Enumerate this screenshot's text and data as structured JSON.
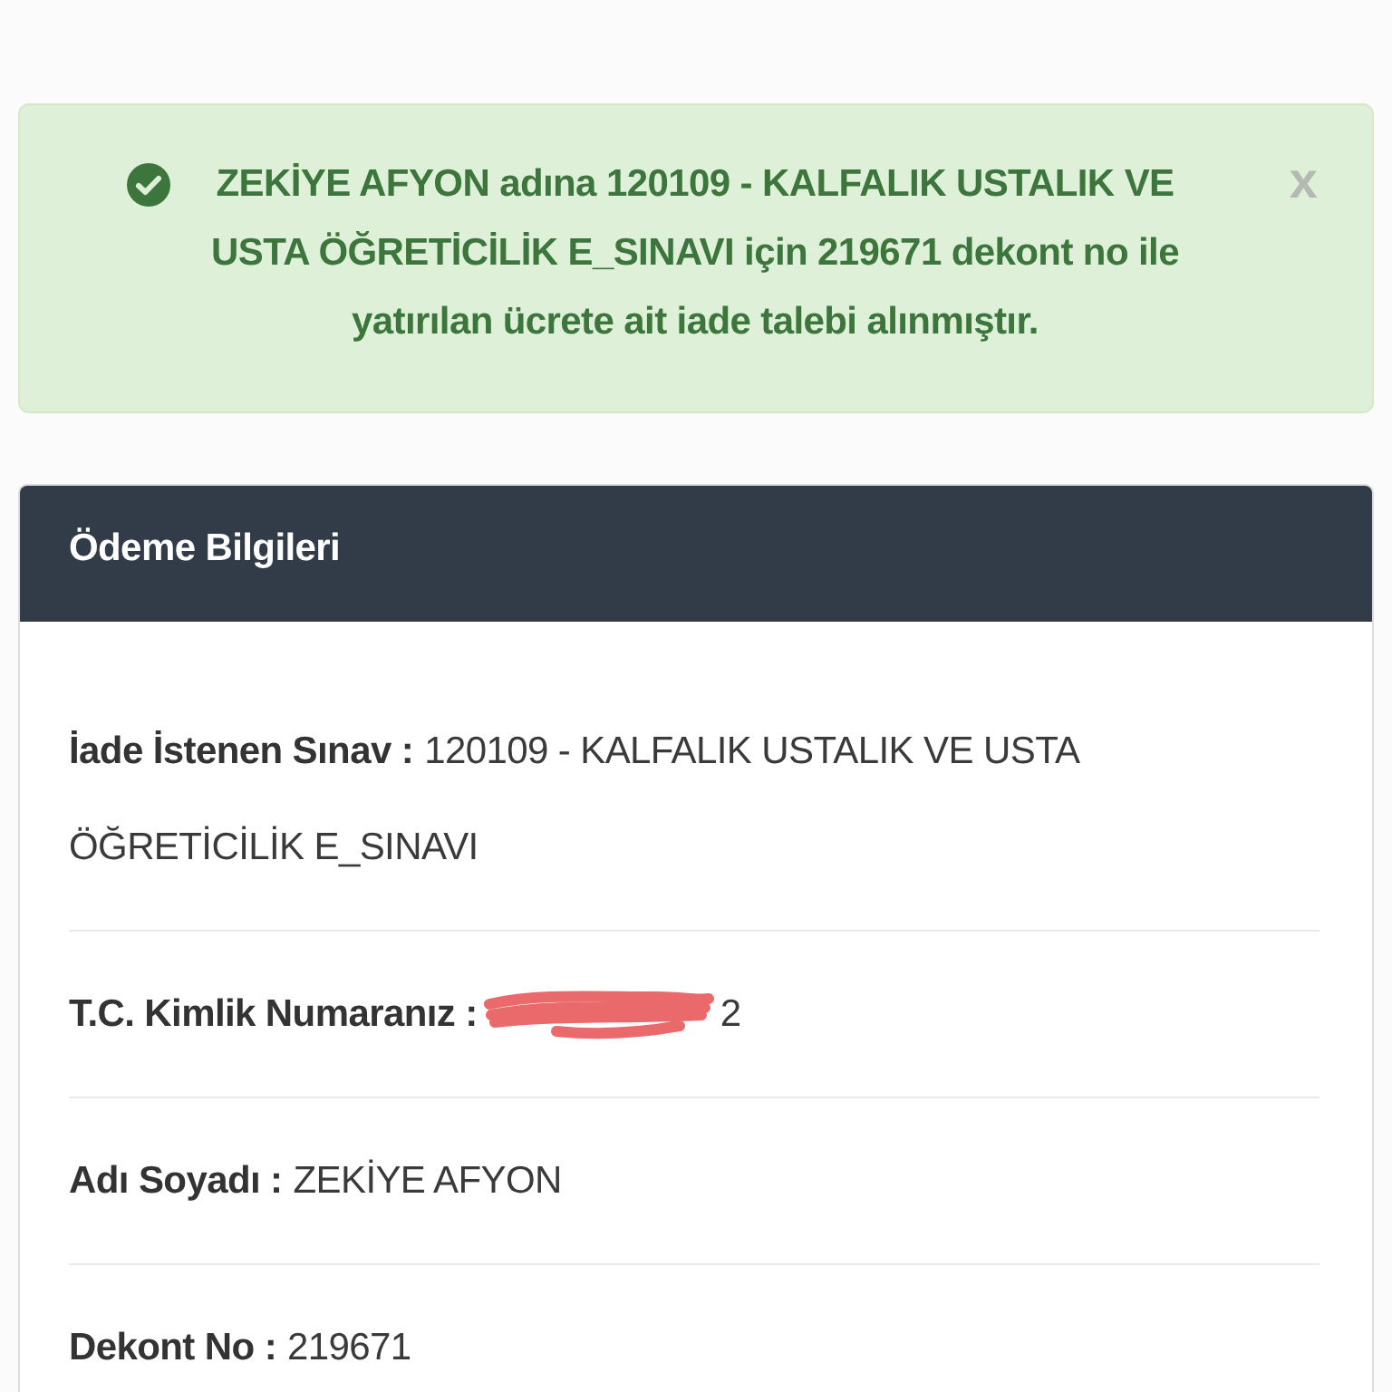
{
  "alert": {
    "kind": "success",
    "message": "ZEKİYE AFYON adına 120109 - KALFALIK USTALIK VE USTA ÖĞRETİCİLİK E_SINAVI için 219671 dekont no ile yatırılan ücrete ait iade talebi alınmıştır.",
    "close": "x"
  },
  "card": {
    "title": "Ödeme Bilgileri",
    "fields": [
      {
        "kind": "plain",
        "label": "İade İstenen Sınav :",
        "value": "120109 - KALFALIK USTALIK VE USTA ÖĞRETİCİLİK E_SINAVI"
      },
      {
        "kind": "redacted",
        "label": "T.C. Kimlik Numaranız :",
        "value": "2"
      },
      {
        "kind": "plain",
        "label": "Adı Soyadı :",
        "value": "ZEKİYE AFYON"
      },
      {
        "kind": "plain",
        "label": "Dekont No :",
        "value": "219671"
      }
    ]
  }
}
